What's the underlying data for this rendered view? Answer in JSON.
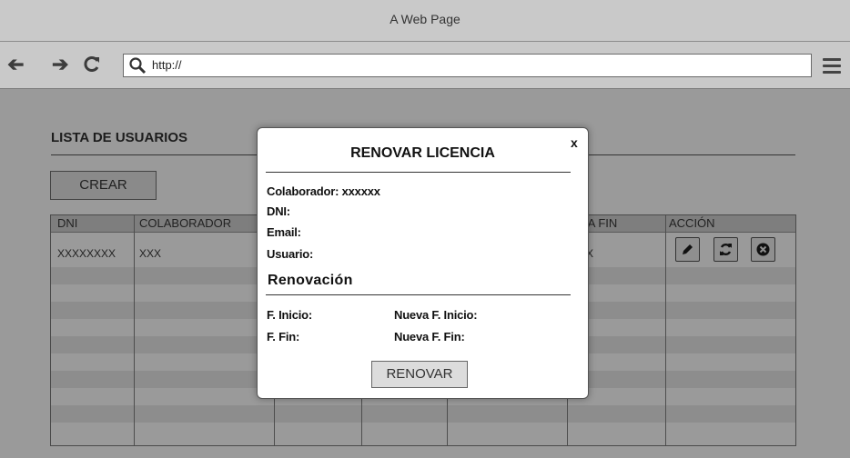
{
  "window": {
    "title": "A Web Page"
  },
  "browser": {
    "back_icon": "back-arrow-icon",
    "forward_icon": "forward-arrow-icon",
    "reload_icon": "reload-icon",
    "url": "http://",
    "search_icon": "search-icon",
    "menu_icon": "hamburger-menu-icon"
  },
  "page": {
    "title": "LISTA DE USUARIOS",
    "create_label": "CREAR",
    "table": {
      "columns": [
        "DNI",
        "COLABORADOR",
        "",
        "",
        "",
        "CHA FIN",
        "ACCIÓN"
      ],
      "rows": [
        [
          "XXXXXXXX",
          "XXX",
          "",
          "",
          "",
          "X",
          ""
        ]
      ],
      "action_icons": [
        "edit-icon",
        "refresh-icon",
        "delete-icon"
      ]
    }
  },
  "modal": {
    "title": "RENOVAR LICENCIA",
    "close_label": "x",
    "fields": {
      "colaborador": "Colaborador: xxxxxx",
      "dni": "DNI:",
      "email": "Email:",
      "usuario": "Usuario:"
    },
    "renewal_heading": "Renovación",
    "renewal": {
      "f_inicio": "F. Inicio:",
      "nueva_f_inicio": "Nueva F. Inicio:",
      "f_fin": "F. Fin:",
      "nueva_f_fin": "Nueva F. Fin:"
    },
    "submit_label": "RENOVAR"
  }
}
